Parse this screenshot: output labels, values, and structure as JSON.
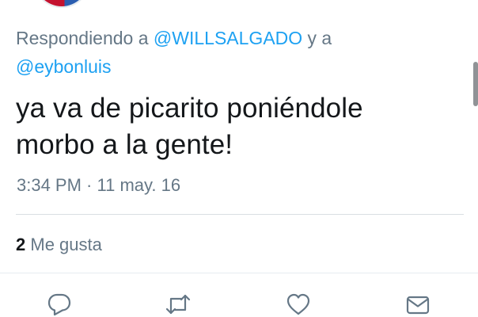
{
  "reply": {
    "prefix": "Respondiendo a ",
    "mention_1": "@WILLSALGADO",
    "joiner": " y a",
    "mention_2": "@eybonluis"
  },
  "tweet": {
    "line_1": "ya va de picarito poniéndole",
    "line_2": "morbo a la gente!"
  },
  "meta": {
    "time": "3:34 PM",
    "separator": " · ",
    "date": "11 may. 16"
  },
  "stats": {
    "likes_count": "2",
    "likes_label": " Me gusta"
  },
  "actions": [
    {
      "icon": "reply-icon"
    },
    {
      "icon": "retweet-icon"
    },
    {
      "icon": "heart-icon"
    },
    {
      "icon": "mail-icon"
    }
  ],
  "colors": {
    "link": "#1da1f2",
    "secondary_text": "#657786",
    "primary_text": "#14171a"
  }
}
